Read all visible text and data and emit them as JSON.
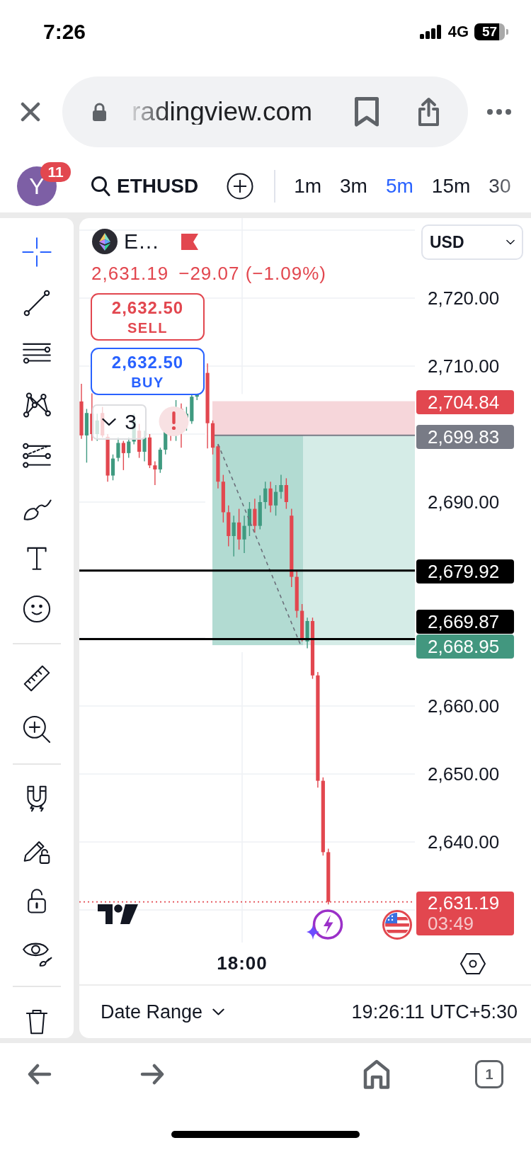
{
  "status_bar": {
    "time": "7:26",
    "network": "4G",
    "battery": "57"
  },
  "browser": {
    "url": "radingview.com"
  },
  "toolbar": {
    "avatar": "Y",
    "notifications": "11",
    "symbol": "ETHUSD",
    "intervals": [
      {
        "label": "1m",
        "selected": false
      },
      {
        "label": "3m",
        "selected": false
      },
      {
        "label": "5m",
        "selected": true
      },
      {
        "label": "15m",
        "selected": false
      },
      {
        "label": "30",
        "selected": false
      }
    ]
  },
  "tool_groups": [
    {
      "tools": [
        {
          "kind": "crosshair",
          "selected": true
        },
        {
          "kind": "trendline",
          "selected": false
        },
        {
          "kind": "levels",
          "selected": false
        },
        {
          "kind": "pattern",
          "selected": false
        },
        {
          "kind": "forecast",
          "selected": false
        },
        {
          "kind": "brush",
          "selected": false
        },
        {
          "kind": "text",
          "selected": false
        },
        {
          "kind": "emoji",
          "selected": false
        }
      ]
    },
    {
      "tools": [
        {
          "kind": "ruler",
          "selected": false
        },
        {
          "kind": "zoom",
          "selected": false
        }
      ]
    },
    {
      "tools": [
        {
          "kind": "magnet",
          "selected": false
        },
        {
          "kind": "editlock",
          "selected": false
        },
        {
          "kind": "lock",
          "selected": false
        },
        {
          "kind": "visibility",
          "selected": false
        }
      ]
    },
    {
      "tools": [
        {
          "kind": "trash",
          "selected": false
        }
      ]
    }
  ],
  "legend": {
    "symbol": "E…",
    "price": "2,631.19",
    "change": "−29.07 (−1.09%)"
  },
  "trade_buttons": [
    {
      "kind": "sell",
      "price": "2,632.50",
      "label": "SELL"
    },
    {
      "kind": "buy",
      "price": "2,632.50",
      "label": "BUY"
    }
  ],
  "indicators": {
    "count": "3"
  },
  "price_axis": {
    "currency": "USD",
    "ticks": [
      "2,720.00",
      "2,710.00",
      "2,690.00",
      "2,660.00",
      "2,650.00",
      "2,640.00"
    ]
  },
  "price_tags": [
    {
      "text": "2,704.84",
      "color": "#e2474f"
    },
    {
      "text": "2,699.83",
      "color": "#787b86"
    },
    {
      "text": "2,679.92",
      "color": "#000000"
    },
    {
      "text": "2,669.87",
      "color": "#000000"
    },
    {
      "text": "2,668.95",
      "color": "#42977f"
    },
    {
      "text": "2,631.19",
      "sub": "03:49",
      "color": "#e2474f"
    }
  ],
  "time_axis": {
    "labels": [
      "18:00"
    ]
  },
  "footer": {
    "date_range": "Date Range",
    "clock": "19:26:11 UTC+5:30"
  },
  "bottom_nav": {
    "tabs": "1"
  }
}
